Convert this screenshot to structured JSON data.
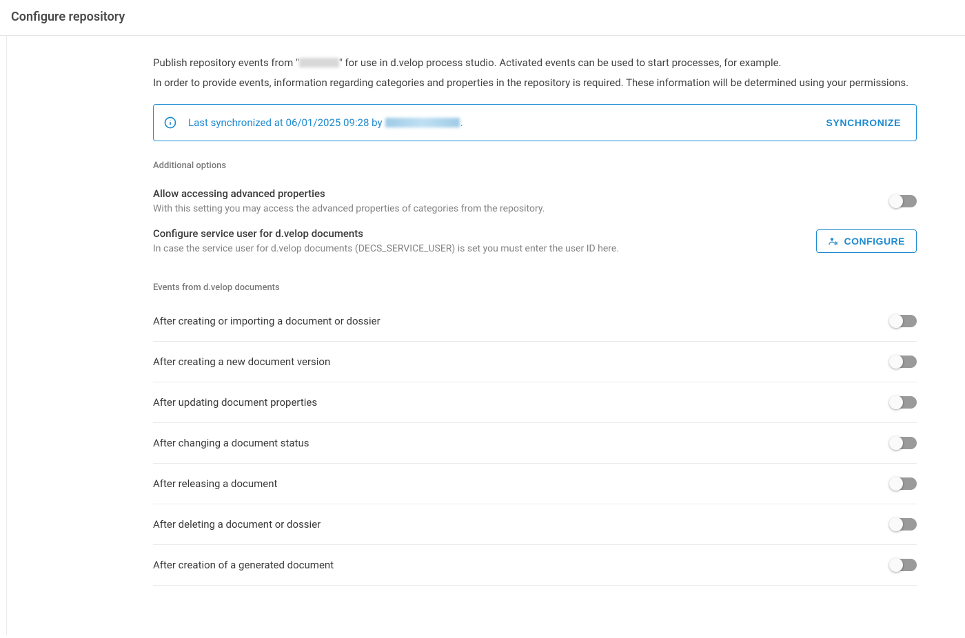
{
  "header": {
    "title": "Configure repository"
  },
  "intro": {
    "p1_prefix": "Publish repository events from \"",
    "p1_suffix": "\" for use in d.velop process studio. Activated events can be used to start processes, for example.",
    "p2": "In order to provide events, information regarding categories and properties in the repository is required. These information will be determined using your permissions."
  },
  "sync_banner": {
    "text_prefix": "Last synchronized at 06/01/2025 09:28 by ",
    "text_suffix": ".",
    "button_label": "SYNCHRONIZE"
  },
  "sections": {
    "additional_options_label": "Additional options",
    "events_label": "Events from d.velop documents"
  },
  "options": {
    "advanced_props": {
      "title": "Allow accessing advanced properties",
      "desc": "With this setting you may access the advanced properties of categories from the repository."
    },
    "service_user": {
      "title": "Configure service user for d.velop documents",
      "desc": "In case the service user for d.velop documents (DECS_SERVICE_USER) is set you must enter the user ID here.",
      "button_label": "CONFIGURE"
    }
  },
  "events": [
    {
      "label": "After creating or importing a document or dossier"
    },
    {
      "label": "After creating a new document version"
    },
    {
      "label": "After updating document properties"
    },
    {
      "label": "After changing a document status"
    },
    {
      "label": "After releasing a document"
    },
    {
      "label": "After deleting a document or dossier"
    },
    {
      "label": "After creation of a generated document"
    }
  ]
}
